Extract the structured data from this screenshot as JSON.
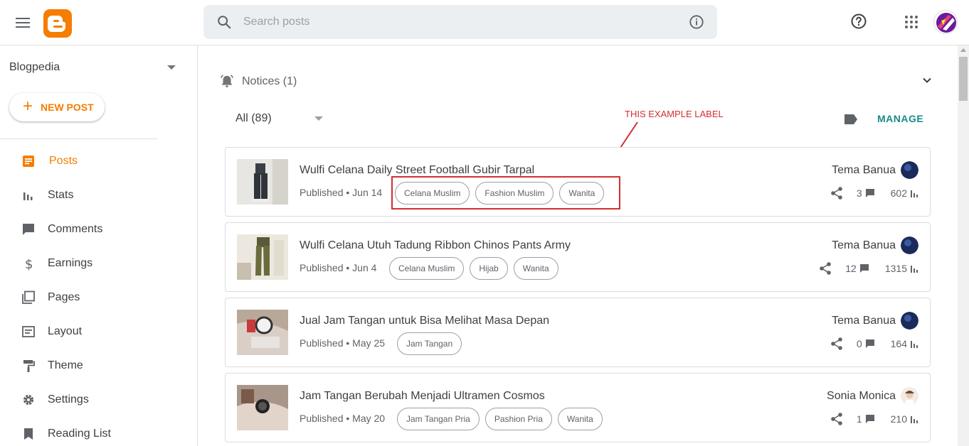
{
  "header": {
    "search_placeholder": "Search posts"
  },
  "sidebar": {
    "blog_name": "Blogpedia",
    "new_post_label": "NEW POST",
    "items": [
      {
        "label": "Posts",
        "icon": "posts-icon",
        "active": true
      },
      {
        "label": "Stats",
        "icon": "stats-icon"
      },
      {
        "label": "Comments",
        "icon": "comments-icon"
      },
      {
        "label": "Earnings",
        "icon": "dollar-icon"
      },
      {
        "label": "Pages",
        "icon": "pages-icon"
      },
      {
        "label": "Layout",
        "icon": "layout-icon"
      },
      {
        "label": "Theme",
        "icon": "paint-roller-icon"
      },
      {
        "label": "Settings",
        "icon": "gear-icon"
      },
      {
        "label": "Reading List",
        "icon": "bookmark-icon"
      }
    ]
  },
  "main": {
    "notices_label": "Notices (1)",
    "filter_label": "All (89)",
    "manage_label": "MANAGE",
    "annotation": "THIS EXAMPLE LABEL",
    "posts": [
      {
        "title": "Wulfi Celana Daily Street Football Gubir Tarpal",
        "status": "Published • Jun 14",
        "labels": [
          "Celana Muslim",
          "Fashion Muslim",
          "Wanita"
        ],
        "author": "Tema Banua",
        "comments": "3",
        "views": "602"
      },
      {
        "title": "Wulfi Celana Utuh Tadung Ribbon Chinos Pants Army",
        "status": "Published • Jun 4",
        "labels": [
          "Celana Muslim",
          "Hijab",
          "Wanita"
        ],
        "author": "Tema Banua",
        "comments": "12",
        "views": "1315"
      },
      {
        "title": "Jual Jam Tangan untuk Bisa Melihat Masa Depan",
        "status": "Published • May 25",
        "labels": [
          "Jam Tangan"
        ],
        "author": "Tema Banua",
        "comments": "0",
        "views": "164"
      },
      {
        "title": "Jam Tangan Berubah Menjadi Ultramen Cosmos",
        "status": "Published • May 20",
        "labels": [
          "Jam Tangan Pria",
          "Pashion Pria",
          "Wanita"
        ],
        "author": "Sonia Monica",
        "comments": "1",
        "views": "210"
      }
    ]
  },
  "colors": {
    "accent": "#f57d00",
    "manage": "#1a8a8a",
    "annotation": "#d32f2f"
  }
}
